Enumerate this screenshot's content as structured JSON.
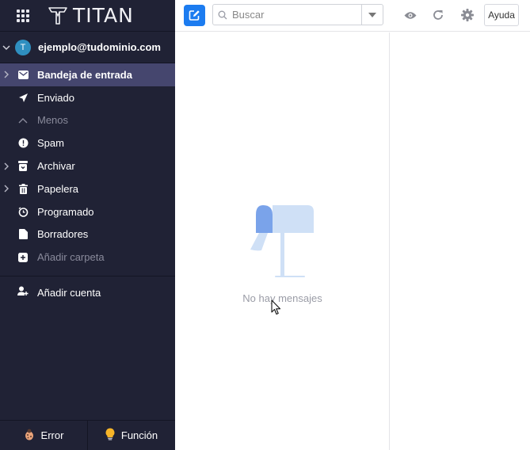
{
  "brand": {
    "name": "TITAN"
  },
  "account": {
    "initial": "T",
    "email": "ejemplo@tudominio.com"
  },
  "folders": [
    {
      "label": "Bandeja de entrada",
      "icon": "envelope-icon",
      "expandable": true,
      "active": true
    },
    {
      "label": "Enviado",
      "icon": "send-icon",
      "expandable": false,
      "active": false
    },
    {
      "label": "Menos",
      "icon": "chevron-up-icon",
      "expandable": false,
      "active": false,
      "muted": true
    },
    {
      "label": "Spam",
      "icon": "alert-icon",
      "expandable": false,
      "active": false
    },
    {
      "label": "Archivar",
      "icon": "archive-icon",
      "expandable": true,
      "active": false
    },
    {
      "label": "Papelera",
      "icon": "trash-icon",
      "expandable": true,
      "active": false
    },
    {
      "label": "Programado",
      "icon": "clock-icon",
      "expandable": false,
      "active": false
    },
    {
      "label": "Borradores",
      "icon": "draft-icon",
      "expandable": false,
      "active": false
    },
    {
      "label": "Añadir carpeta",
      "icon": "plus-square-icon",
      "expandable": false,
      "active": false,
      "muted": true
    }
  ],
  "add_account": {
    "label": "Añadir cuenta"
  },
  "footer": {
    "error_label": "Error",
    "feature_label": "Función"
  },
  "search": {
    "placeholder": "Buscar",
    "value": ""
  },
  "toolbar": {
    "help_label": "Ayuda"
  },
  "list": {
    "empty_text": "No hay mensajes"
  },
  "colors": {
    "sidebar_bg": "#202235",
    "active_bg": "#45466e",
    "accent": "#1c7cf0",
    "avatar": "#2f8fc0"
  }
}
